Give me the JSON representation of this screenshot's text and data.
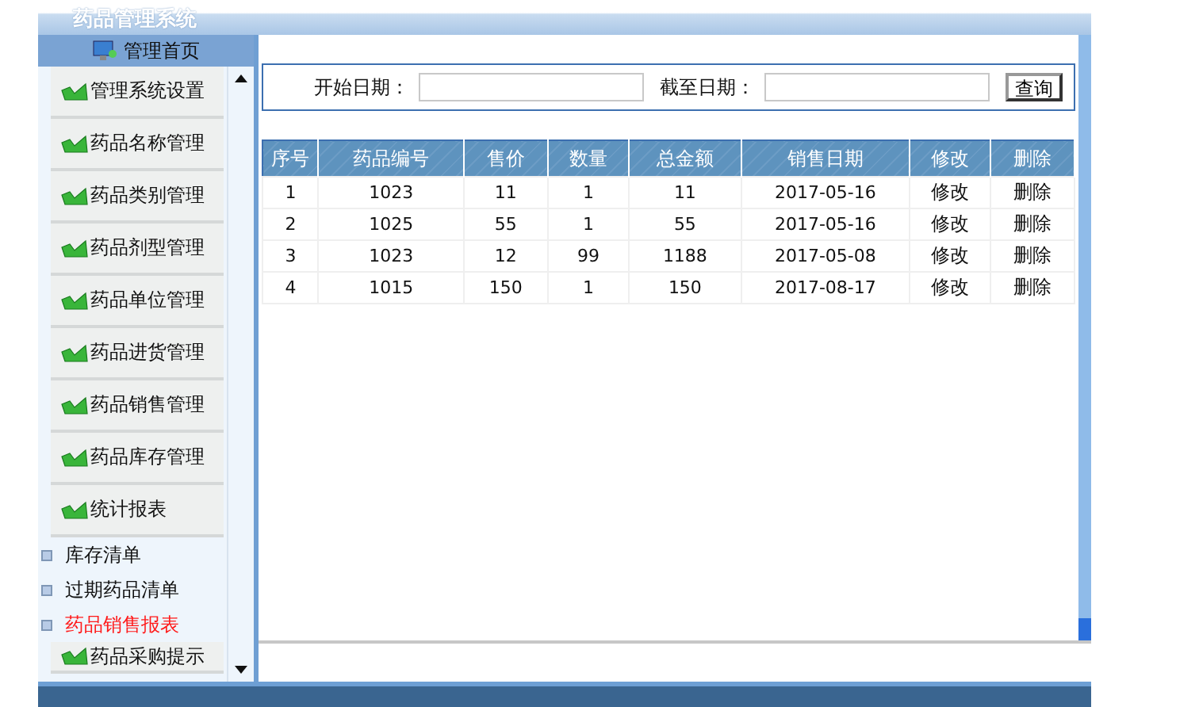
{
  "window": {
    "title": "药品管理系统"
  },
  "sidebar": {
    "home": "管理首页",
    "items": [
      {
        "kind": "section",
        "label": "管理系统设置"
      },
      {
        "kind": "section",
        "label": "药品名称管理"
      },
      {
        "kind": "section",
        "label": "药品类别管理"
      },
      {
        "kind": "section",
        "label": "药品剂型管理"
      },
      {
        "kind": "section",
        "label": "药品单位管理"
      },
      {
        "kind": "section",
        "label": "药品进货管理"
      },
      {
        "kind": "section",
        "label": "药品销售管理"
      },
      {
        "kind": "section",
        "label": "药品库存管理"
      },
      {
        "kind": "section",
        "label": "统计报表"
      },
      {
        "kind": "sub",
        "label": "库存清单",
        "selected": false
      },
      {
        "kind": "sub",
        "label": "过期药品清单",
        "selected": false
      },
      {
        "kind": "sub",
        "label": "药品销售报表",
        "selected": true
      },
      {
        "kind": "section",
        "label": "药品采购提示"
      }
    ]
  },
  "search": {
    "start_label": "开始日期：",
    "end_label": "截至日期：",
    "button": "查询"
  },
  "table": {
    "columns": [
      "序号",
      "药品编号",
      "售价",
      "数量",
      "总金额",
      "销售日期",
      "修改",
      "删除"
    ],
    "rows": [
      [
        "1",
        "1023",
        "11",
        "1",
        "11",
        "2017-05-16",
        "修改",
        "删除"
      ],
      [
        "2",
        "1025",
        "55",
        "1",
        "55",
        "2017-05-16",
        "修改",
        "删除"
      ],
      [
        "3",
        "1023",
        "12",
        "99",
        "1188",
        "2017-05-08",
        "修改",
        "删除"
      ],
      [
        "4",
        "1015",
        "150",
        "1",
        "150",
        "2017-08-17",
        "修改",
        "删除"
      ]
    ]
  }
}
